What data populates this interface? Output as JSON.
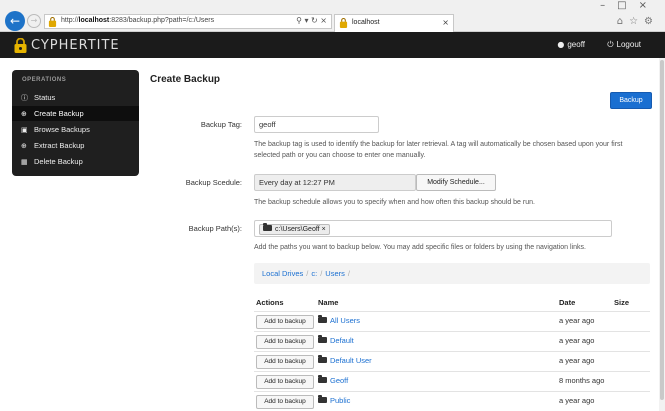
{
  "browser": {
    "url_prefix": "http://",
    "url_host": "localhost",
    "url_rest": ":8283/backup.php?path=/c:/Users",
    "tab_title": "localhost"
  },
  "app": {
    "brand": "CYPHERTITE",
    "user": "geoff",
    "logout": "Logout"
  },
  "sidebar": {
    "heading": "OPERATIONS",
    "items": [
      {
        "label": "Status",
        "icon": "info-icon"
      },
      {
        "label": "Create Backup",
        "icon": "plus-icon"
      },
      {
        "label": "Browse Backups",
        "icon": "folder-icon"
      },
      {
        "label": "Extract Backup",
        "icon": "download-icon"
      },
      {
        "label": "Delete Backup",
        "icon": "trash-icon"
      }
    ]
  },
  "main": {
    "title": "Create Backup",
    "backup_button": "Backup",
    "tag_label": "Backup Tag:",
    "tag_value": "geoff",
    "tag_help": "The backup tag is used to identify the backup for later retrieval. A tag will automatically be chosen based upon your first selected path or you can choose to enter one manually.",
    "schedule_label": "Backup Scedule:",
    "schedule_value": "Every day at 12:27 PM",
    "modify_button": "Modify Schedule...",
    "schedule_help": "The backup schedule allows you to specify when and how often this backup should be run.",
    "paths_label": "Backup Path(s):",
    "path_tag": "c:\\Users\\Geoff",
    "paths_help": "Add the paths you want to backup below. You may add specific files or folders by using the navigation links."
  },
  "breadcrumb": [
    "Local Drives",
    "c:",
    "Users"
  ],
  "table": {
    "headers": {
      "actions": "Actions",
      "name": "Name",
      "date": "Date",
      "size": "Size"
    },
    "add_label": "Add to backup",
    "rows": [
      {
        "name": "All Users",
        "date": "a year ago"
      },
      {
        "name": "Default",
        "date": "a year ago"
      },
      {
        "name": "Default User",
        "date": "a year ago"
      },
      {
        "name": "Geoff",
        "date": "8 months ago"
      },
      {
        "name": "Public",
        "date": "a year ago"
      }
    ]
  },
  "colors": {
    "accent": "#1a6fd1",
    "header_bg": "#1b1b1b",
    "sidebar_bg": "#1f1f1f"
  }
}
